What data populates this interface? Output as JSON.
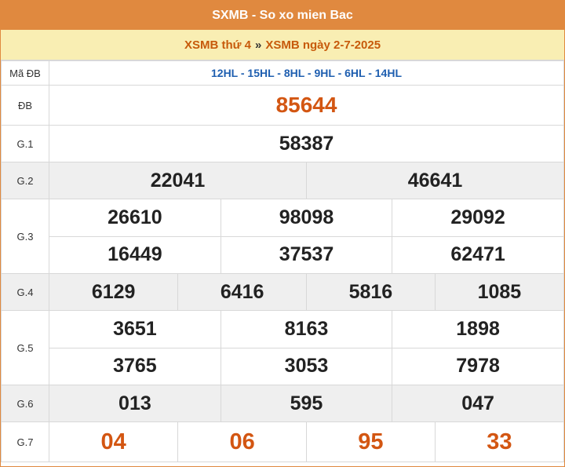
{
  "header": {
    "title": "SXMB - So xo mien Bac",
    "link_weekday": "XSMB thứ 4",
    "separator": "»",
    "link_date": "XSMB ngày 2-7-2025"
  },
  "code_row": {
    "label": "Mã ĐB",
    "codes": "12HL - 15HL - 8HL - 9HL - 6HL - 14HL"
  },
  "prizes": {
    "db": {
      "label": "ĐB",
      "numbers": [
        "85644"
      ]
    },
    "g1": {
      "label": "G.1",
      "numbers": [
        "58387"
      ]
    },
    "g2": {
      "label": "G.2",
      "numbers": [
        "22041",
        "46641"
      ]
    },
    "g3": {
      "label": "G.3",
      "numbers": [
        "26610",
        "98098",
        "29092",
        "16449",
        "37537",
        "62471"
      ]
    },
    "g4": {
      "label": "G.4",
      "numbers": [
        "6129",
        "6416",
        "5816",
        "1085"
      ]
    },
    "g5": {
      "label": "G.5",
      "numbers": [
        "3651",
        "8163",
        "1898",
        "3765",
        "3053",
        "7978"
      ]
    },
    "g6": {
      "label": "G.6",
      "numbers": [
        "013",
        "595",
        "047"
      ]
    },
    "g7": {
      "label": "G.7",
      "numbers": [
        "04",
        "06",
        "95",
        "33"
      ]
    }
  },
  "colors": {
    "header_bg": "#e0893f",
    "subheader_bg": "#f9eeb3",
    "special_number": "#d35612",
    "code_text": "#1f5fb0",
    "row_alt_bg": "#efefef"
  }
}
